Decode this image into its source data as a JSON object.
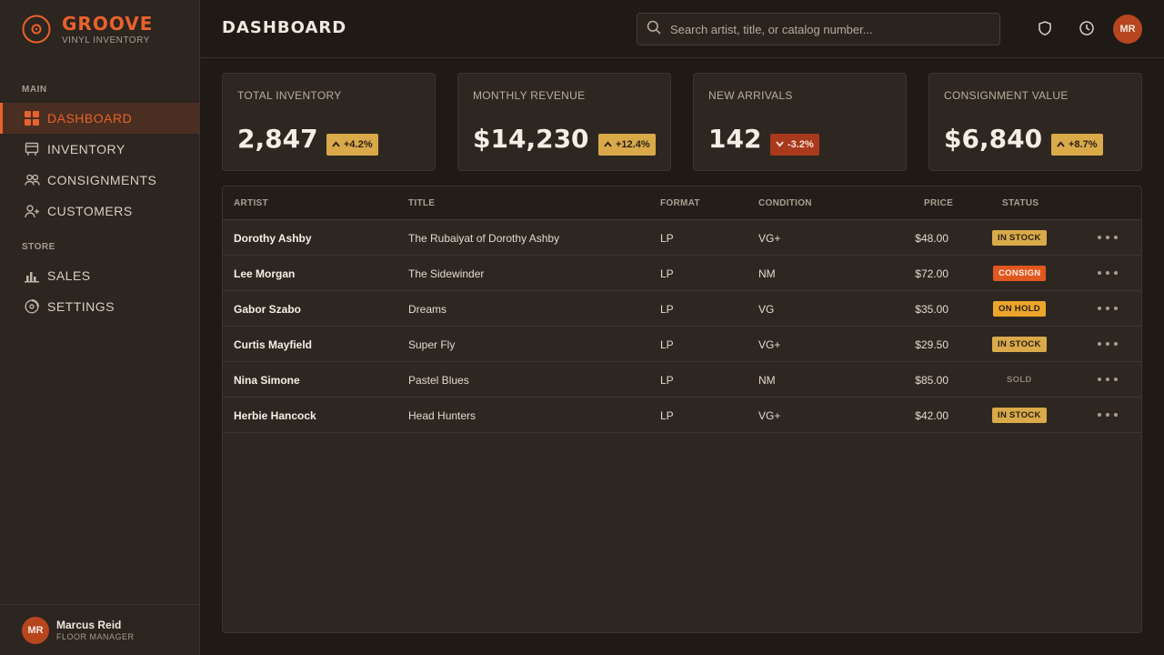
{
  "brand": {
    "name": "GROOVE",
    "subtitle": "VINYL INVENTORY"
  },
  "sidebar": {
    "sections": [
      {
        "label": "MAIN"
      },
      {
        "label": "STORE"
      }
    ],
    "items": [
      {
        "label": "DASHBOARD",
        "icon": "grid-icon",
        "active": true
      },
      {
        "label": "INVENTORY",
        "icon": "crate-icon"
      },
      {
        "label": "CONSIGNMENTS",
        "icon": "users-icon"
      },
      {
        "label": "CUSTOMERS",
        "icon": "user-plus-icon"
      },
      {
        "label": "SALES",
        "icon": "bar-chart-icon"
      },
      {
        "label": "SETTINGS",
        "icon": "record-icon"
      }
    ],
    "user": {
      "initials": "MR",
      "name": "Marcus Reid",
      "role": "FLOOR MANAGER"
    }
  },
  "header": {
    "title": "DASHBOARD",
    "search_placeholder": "Search artist, title, or catalog number...",
    "avatar_initials": "MR"
  },
  "stats": [
    {
      "label": "TOTAL INVENTORY",
      "value": "2,847",
      "delta": "+4.2%",
      "direction": "up"
    },
    {
      "label": "MONTHLY REVENUE",
      "value": "$14,230",
      "delta": "+12.4%",
      "direction": "up"
    },
    {
      "label": "NEW ARRIVALS",
      "value": "142",
      "delta": "-3.2%",
      "direction": "down"
    },
    {
      "label": "CONSIGNMENT VALUE",
      "value": "$6,840",
      "delta": "+8.7%",
      "direction": "up"
    }
  ],
  "table": {
    "columns": [
      "ARTIST",
      "TITLE",
      "FORMAT",
      "CONDITION",
      "PRICE",
      "STATUS"
    ],
    "rows": [
      {
        "artist": "Dorothy Ashby",
        "title": "The Rubaiyat of Dorothy Ashby",
        "format": "LP",
        "condition": "VG+",
        "price": "$48.00",
        "status": "IN STOCK"
      },
      {
        "artist": "Lee Morgan",
        "title": "The Sidewinder",
        "format": "LP",
        "condition": "NM",
        "price": "$72.00",
        "status": "CONSIGN"
      },
      {
        "artist": "Gabor Szabo",
        "title": "Dreams",
        "format": "LP",
        "condition": "VG",
        "price": "$35.00",
        "status": "ON HOLD"
      },
      {
        "artist": "Curtis Mayfield",
        "title": "Super Fly",
        "format": "LP",
        "condition": "VG+",
        "price": "$29.50",
        "status": "IN STOCK"
      },
      {
        "artist": "Nina Simone",
        "title": "Pastel Blues",
        "format": "LP",
        "condition": "NM",
        "price": "$85.00",
        "status": "SOLD"
      },
      {
        "artist": "Herbie Hancock",
        "title": "Head Hunters",
        "format": "LP",
        "condition": "VG+",
        "price": "$42.00",
        "status": "IN STOCK"
      }
    ]
  },
  "colors": {
    "accent": "#e8622c",
    "background": "#1f1a16",
    "panel": "#2e2721",
    "status_in_stock": "#d9a94a",
    "status_consign": "#e0571f",
    "status_on_hold": "#eba629",
    "delta_down": "#a8391d"
  }
}
